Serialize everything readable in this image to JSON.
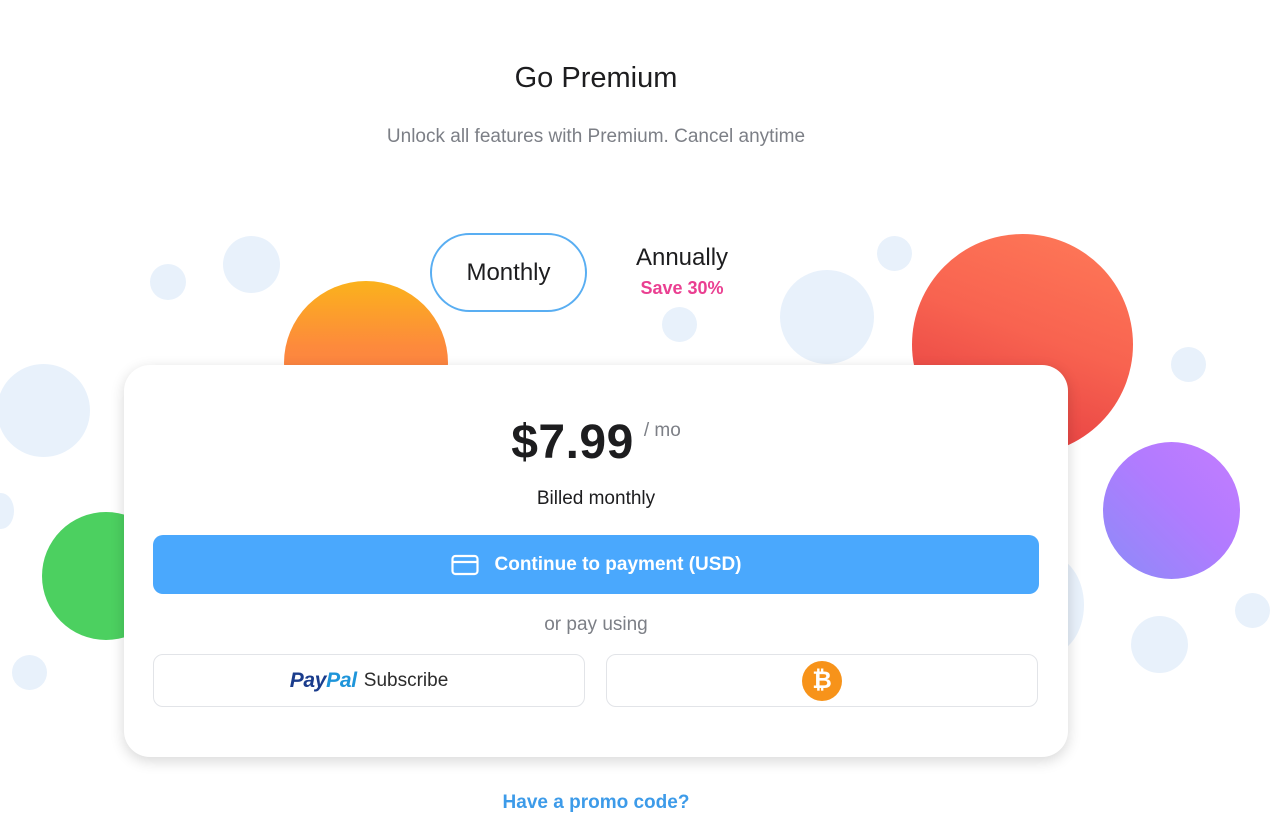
{
  "header": {
    "title": "Go Premium",
    "subtitle": "Unlock all features with Premium. Cancel anytime"
  },
  "billing_toggle": {
    "monthly_label": "Monthly",
    "annually_label": "Annually",
    "annually_badge": "Save 30%",
    "selected": "Monthly"
  },
  "plan_card": {
    "price": "$7.99",
    "unit": "/ mo",
    "billed": "Billed monthly",
    "pay_button_label": "Continue to payment (USD)",
    "pay_button_icon": "credit-card-icon",
    "or_label": "or pay using",
    "paypal": {
      "brand_pay": "Pay",
      "brand_pal": "Pal",
      "label": "Subscribe",
      "icon": "paypal-logo"
    },
    "bitcoin": {
      "symbol": "₿",
      "icon": "bitcoin-icon"
    }
  },
  "promo_link": "Have a promo code?",
  "colors": {
    "accent": "#4aa8fd",
    "toggle_border": "#59aef2",
    "save_badge": "#ea3f91",
    "link": "#3d9be9",
    "bitcoin": "#f7931a",
    "paypal_dark": "#1a3c8c",
    "paypal_light": "#1e95da"
  }
}
